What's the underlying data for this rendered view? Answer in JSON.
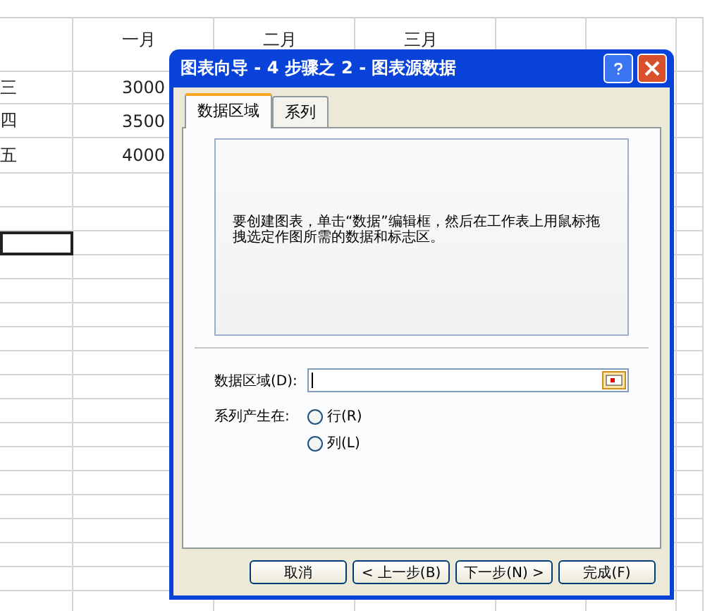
{
  "sheet": {
    "header": [
      "一月",
      "二月",
      "三月"
    ],
    "rows": [
      [
        "三",
        "3000"
      ],
      [
        "四",
        "3500"
      ],
      [
        "五",
        "4000"
      ]
    ]
  },
  "dialog": {
    "title": "图表向导 - 4 步骤之 2 - 图表源数据",
    "tabs": [
      {
        "label": "数据区域",
        "selected": true
      },
      {
        "label": "系列",
        "selected": false
      }
    ],
    "preview_text": "要创建图表，单击“数据”编辑框，然后在工作表上用鼠标拖拽选定作图所需的数据和标志区。",
    "range_label": "数据区域(D):",
    "series_label": "系列产生在:",
    "series_options": [
      {
        "label": "行(R)",
        "selected": false
      },
      {
        "label": "列(L)",
        "selected": false
      }
    ],
    "buttons": [
      {
        "label": "取消"
      },
      {
        "label": "< 上一步(B)"
      },
      {
        "label": "下一步(N) >"
      },
      {
        "label": "完成(F)"
      }
    ]
  }
}
